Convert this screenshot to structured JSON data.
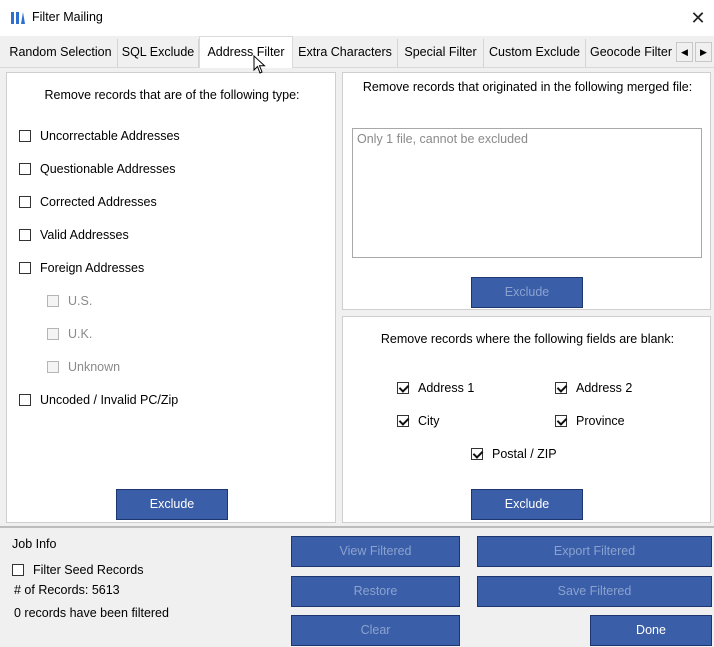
{
  "window": {
    "title": "Filter Mailing",
    "close_glyph": "✕"
  },
  "tabs": [
    {
      "label": "Random Selection"
    },
    {
      "label": "SQL Exclude"
    },
    {
      "label": "Address Filter"
    },
    {
      "label": "Extra Characters"
    },
    {
      "label": "Special Filter"
    },
    {
      "label": "Custom Exclude"
    },
    {
      "label": "Geocode Filter"
    }
  ],
  "active_tab": "Address Filter",
  "tab_scroll": {
    "left_glyph": "◀",
    "right_glyph": "▶"
  },
  "type_panel": {
    "title": "Remove records that are of the following type:",
    "options": [
      {
        "label": "Uncorrectable Addresses",
        "checked": false,
        "disabled": false
      },
      {
        "label": "Questionable Addresses",
        "checked": false,
        "disabled": false
      },
      {
        "label": "Corrected Addresses",
        "checked": false,
        "disabled": false
      },
      {
        "label": "Valid Addresses",
        "checked": false,
        "disabled": false
      },
      {
        "label": "Foreign Addresses",
        "checked": false,
        "disabled": false
      },
      {
        "label": "U.S.",
        "checked": false,
        "disabled": true
      },
      {
        "label": "U.K.",
        "checked": false,
        "disabled": true
      },
      {
        "label": "Unknown",
        "checked": false,
        "disabled": true
      },
      {
        "label": "Uncoded / Invalid PC/Zip",
        "checked": false,
        "disabled": false
      }
    ],
    "exclude_label": "Exclude"
  },
  "merged_panel": {
    "title": "Remove records that originated in the following merged file:",
    "list_placeholder": "Only 1 file, cannot be excluded",
    "exclude_label": "Exclude"
  },
  "blank_panel": {
    "title": "Remove records where the following fields are blank:",
    "fields": [
      {
        "label": "Address 1",
        "checked": true
      },
      {
        "label": "Address 2",
        "checked": true
      },
      {
        "label": "City",
        "checked": true
      },
      {
        "label": "Province",
        "checked": true
      },
      {
        "label": "Postal / ZIP",
        "checked": true
      }
    ],
    "exclude_label": "Exclude"
  },
  "job_info": {
    "title": "Job Info",
    "filter_seed_label": "Filter Seed Records",
    "filter_seed_checked": false,
    "records_count": "# of Records: 5613",
    "filtered_status": "0 records have been filtered"
  },
  "actions": {
    "view_filtered": "View Filtered",
    "export_filtered": "Export Filtered",
    "restore": "Restore",
    "save_filtered": "Save Filtered",
    "clear": "Clear",
    "done": "Done"
  },
  "colors": {
    "button_blue": "#3b5ea8",
    "button_border": "#1e3670",
    "disabled_text": "#8aa2cf"
  }
}
